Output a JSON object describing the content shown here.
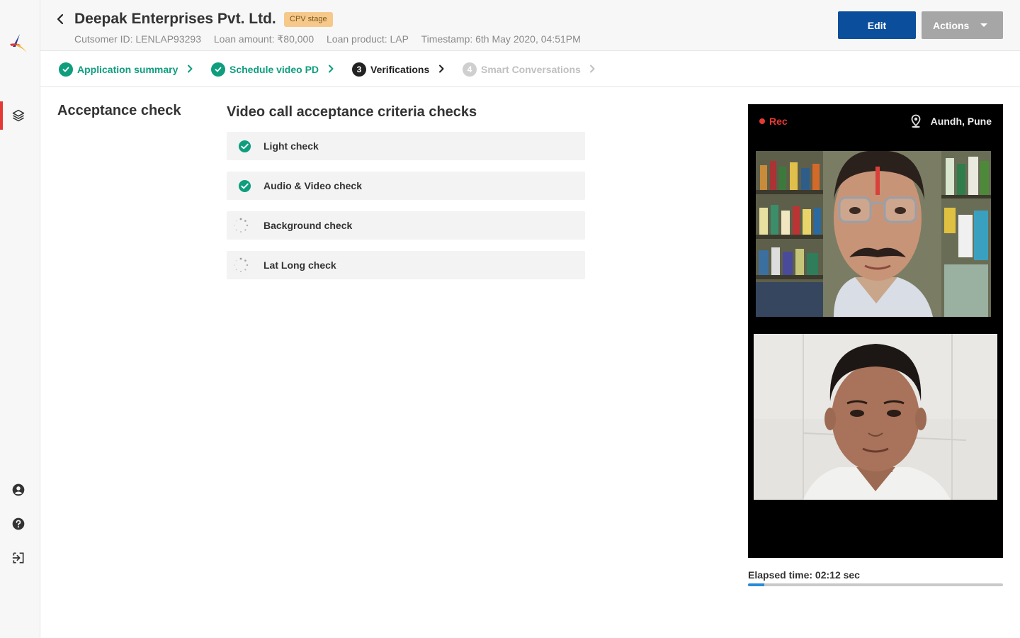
{
  "header": {
    "company_name": "Deepak Enterprises Pvt. Ltd.",
    "stage_badge": "CPV stage",
    "customer_id": "Cutsomer ID: LENLAP93293",
    "loan_amount": "Loan amount: ₹80,000",
    "loan_product": "Loan product: LAP",
    "timestamp": "Timestamp: 6th May 2020, 04:51PM",
    "edit_label": "Edit",
    "actions_label": "Actions"
  },
  "stepper": {
    "steps": [
      {
        "label": "Application summary",
        "state": "done",
        "number": ""
      },
      {
        "label": "Schedule video PD",
        "state": "done",
        "number": ""
      },
      {
        "label": "Verifications",
        "state": "current",
        "number": "3"
      },
      {
        "label": "Smart Conversations",
        "state": "future",
        "number": "4"
      }
    ]
  },
  "main": {
    "section_title": "Acceptance check",
    "checks_title": "Video call acceptance criteria checks",
    "checks": [
      {
        "label": "Light check",
        "status": "done"
      },
      {
        "label": "Audio & Video check",
        "status": "done"
      },
      {
        "label": "Background check",
        "status": "loading"
      },
      {
        "label": "Lat Long check",
        "status": "loading"
      }
    ]
  },
  "video": {
    "rec_label": "Rec",
    "location": "Aundh, Pune",
    "elapsed": "Elapsed time: 02:12 sec",
    "progress_fraction": 0.065
  },
  "colors": {
    "accent_green": "#0e9e7e",
    "primary_blue": "#0b4f9c",
    "rec_red": "#e53935",
    "progress_blue": "#2b8ad6"
  },
  "icons": {
    "sidebar_nav": "layers-icon",
    "sidebar_bottom": [
      "account-circle-icon",
      "help-icon",
      "logout-icon"
    ]
  }
}
